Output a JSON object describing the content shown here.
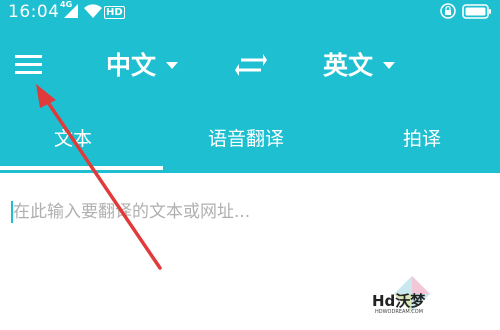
{
  "status_bar": {
    "time": "16:04",
    "network": "4G",
    "hd_badge": "HD",
    "icons": [
      "signal-icon",
      "wifi-icon",
      "lock-icon",
      "battery-icon"
    ]
  },
  "toolbar": {
    "menu_icon": "hamburger-menu-icon",
    "source_language": "中文",
    "target_language": "英文",
    "swap_icon": "swap-arrows-icon"
  },
  "tabs": [
    {
      "label": "文本",
      "selected": true
    },
    {
      "label": "语音翻译",
      "selected": false
    },
    {
      "label": "拍译",
      "selected": false
    }
  ],
  "input": {
    "value": "",
    "placeholder": "在此输入要翻译的文本或网址..."
  },
  "watermark": {
    "title": "Hd沃梦",
    "subtitle": "HDWODREAM.COM"
  },
  "colors": {
    "primary": "#1fbfd2",
    "annotation_arrow": "#e03a3a",
    "background": "#ffffff"
  }
}
